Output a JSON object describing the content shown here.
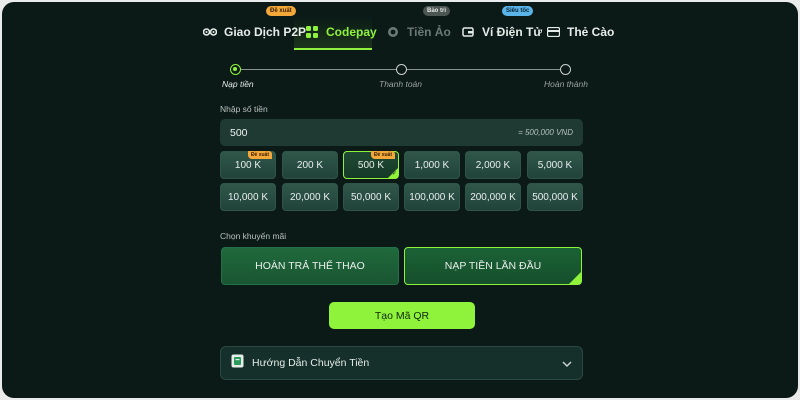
{
  "tabs": [
    {
      "label": "Giao Dịch P2P",
      "badge": "Đề xuất",
      "icon": "p2p-icon"
    },
    {
      "label": "Codepay",
      "badge": "",
      "icon": "codepay-icon"
    },
    {
      "label": "Tiền Ảo",
      "badge": "Bảo trì",
      "icon": "crypto-icon"
    },
    {
      "label": "Ví Điện Tử",
      "badge": "Siêu tốc",
      "icon": "wallet-icon"
    },
    {
      "label": "Thẻ Cào",
      "badge": "",
      "icon": "card-icon"
    }
  ],
  "stepper": {
    "steps": [
      "Nạp tiền",
      "Thanh toán",
      "Hoàn thành"
    ],
    "current": 0
  },
  "amount": {
    "label": "Nhập số tiền",
    "value": "500",
    "converted": "= 500,000 VND"
  },
  "amount_options": {
    "row1": [
      "100 K",
      "200 K",
      "500 K",
      "1,000 K",
      "2,000 K",
      "5,000 K"
    ],
    "row2": [
      "10,000 K",
      "20,000 K",
      "50,000 K",
      "100,000 K",
      "200,000 K",
      "500,000 K"
    ],
    "badge": "Đề xuất",
    "selected": "500 K"
  },
  "promo": {
    "label": "Chọn khuyến mãi",
    "options": [
      "HOÀN TRẢ THỂ THAO",
      "NẠP TIỀN LẦN ĐẦU"
    ],
    "selected": "NẠP TIỀN LẦN ĐẦU"
  },
  "qr_button": "Tạo Mã QR",
  "guide": {
    "label": "Hướng Dẫn Chuyển Tiền",
    "icon": "book-icon"
  },
  "colors": {
    "background": "#0b1a17",
    "accent": "#8ff33c",
    "badge_orange": "#f4a83a",
    "badge_blue": "#5bb4e8"
  }
}
